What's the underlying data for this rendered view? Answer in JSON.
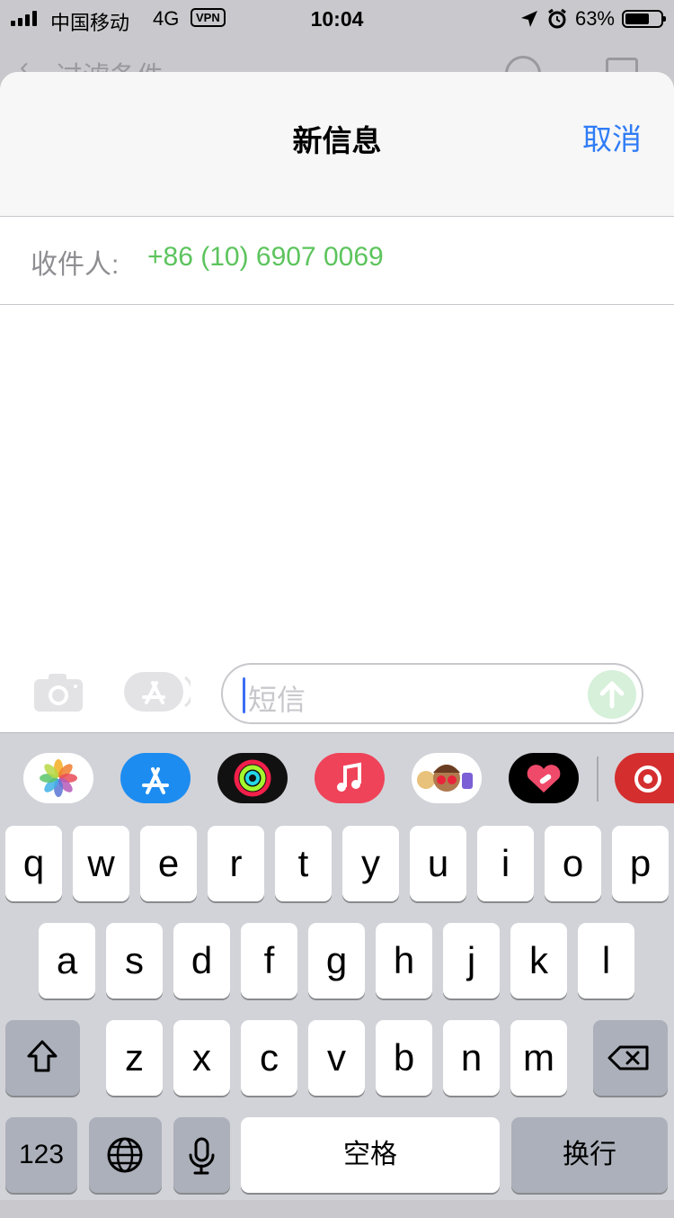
{
  "status_bar": {
    "carrier": "中国移动",
    "network": "4G",
    "vpn": "VPN",
    "time": "10:04",
    "battery": "63%"
  },
  "background": {
    "nav_title": "过滤条件"
  },
  "sheet": {
    "title": "新信息",
    "cancel": "取消",
    "to_label": "收件人:",
    "recipient": "+86 (10) 6907 0069"
  },
  "composer": {
    "placeholder": "短信"
  },
  "apps": [
    "photos",
    "app-store",
    "activity",
    "music",
    "memoji",
    "digital-touch",
    "netease-music"
  ],
  "keyboard": {
    "row1": [
      "q",
      "w",
      "e",
      "r",
      "t",
      "y",
      "u",
      "i",
      "o",
      "p"
    ],
    "row2": [
      "a",
      "s",
      "d",
      "f",
      "g",
      "h",
      "j",
      "k",
      "l"
    ],
    "row3": [
      "z",
      "x",
      "c",
      "v",
      "b",
      "n",
      "m"
    ],
    "numbers": "123",
    "space": "空格",
    "return": "换行"
  },
  "colors": {
    "accent": "#2f7cf6",
    "recipient": "#5cc45d",
    "keyboard_bg": "#d2d3d8"
  }
}
